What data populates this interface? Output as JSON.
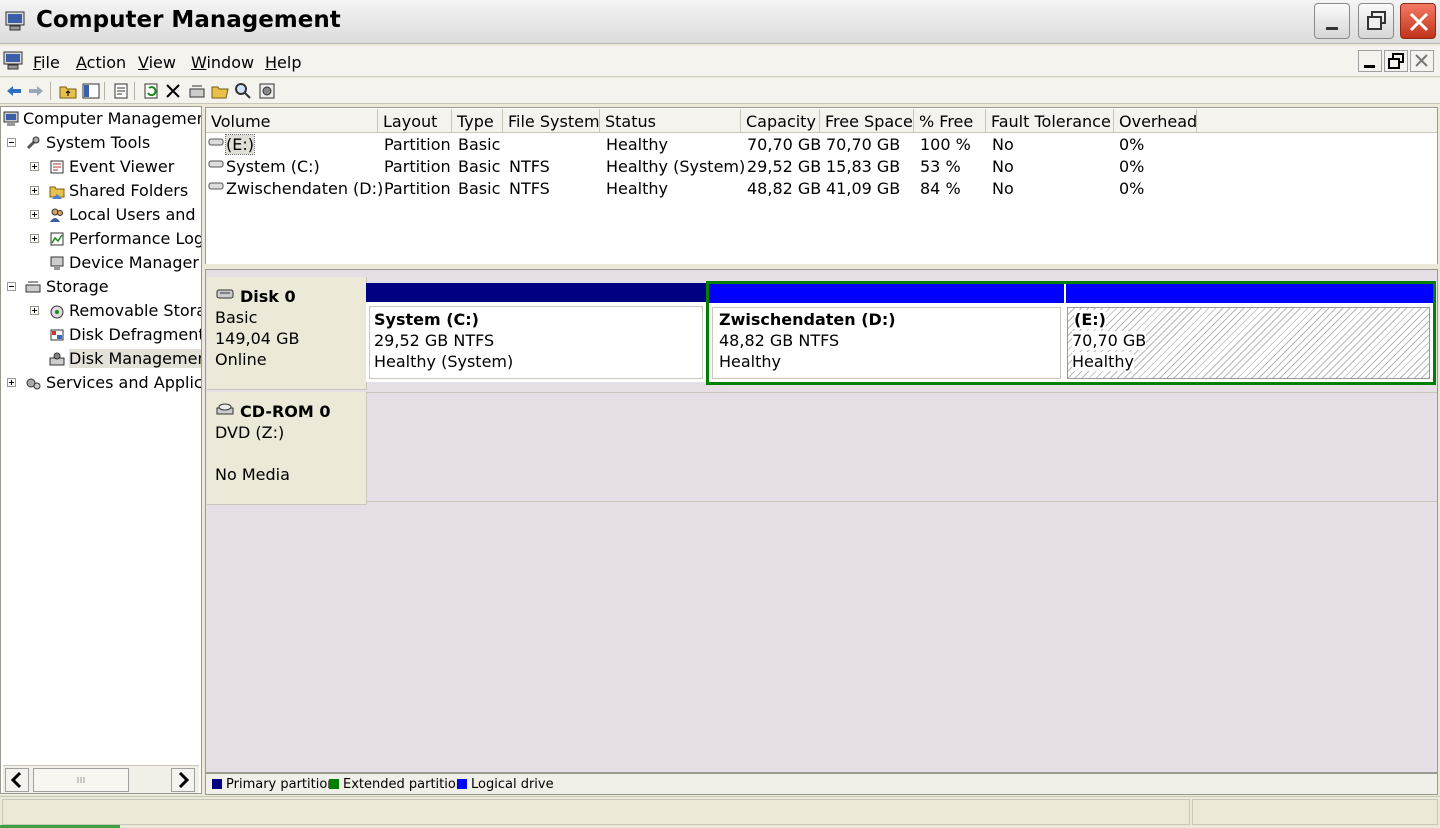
{
  "window": {
    "title": "Computer Management"
  },
  "menu": {
    "items": [
      {
        "label": "File",
        "accel": "F",
        "rest": "ile"
      },
      {
        "label": "Action",
        "accel": "A",
        "rest": "ction"
      },
      {
        "label": "View",
        "accel": "V",
        "rest": "iew"
      },
      {
        "label": "Window",
        "accel": "W",
        "rest": "indow"
      },
      {
        "label": "Help",
        "accel": "H",
        "rest": "elp"
      }
    ]
  },
  "tree": {
    "items": [
      {
        "label": "Computer Management"
      },
      {
        "label": "System Tools"
      },
      {
        "label": "Event Viewer"
      },
      {
        "label": "Shared Folders"
      },
      {
        "label": "Local Users and G"
      },
      {
        "label": "Performance Logs"
      },
      {
        "label": "Device Manager"
      },
      {
        "label": "Storage"
      },
      {
        "label": "Removable Storag"
      },
      {
        "label": "Disk Defragmente"
      },
      {
        "label": "Disk Management"
      },
      {
        "label": "Services and Applica"
      }
    ]
  },
  "volumes": {
    "columns": [
      "Volume",
      "Layout",
      "Type",
      "File System",
      "Status",
      "Capacity",
      "Free Space",
      "% Free",
      "Fault Tolerance",
      "Overhead"
    ],
    "rows": [
      {
        "volume": " (E:)",
        "layout": "Partition",
        "type": "Basic",
        "fs": "",
        "status": "Healthy",
        "capacity": "70,70 GB",
        "free": "70,70 GB",
        "pct": "100 %",
        "fault": "No",
        "overhead": "0%"
      },
      {
        "volume": "System (C:)",
        "layout": "Partition",
        "type": "Basic",
        "fs": "NTFS",
        "status": "Healthy (System)",
        "capacity": "29,52 GB",
        "free": "15,83 GB",
        "pct": "53 %",
        "fault": "No",
        "overhead": "0%"
      },
      {
        "volume": "Zwischendaten (D:)",
        "layout": "Partition",
        "type": "Basic",
        "fs": "NTFS",
        "status": "Healthy",
        "capacity": "48,82 GB",
        "free": "41,09 GB",
        "pct": "84 %",
        "fault": "No",
        "overhead": "0%"
      }
    ]
  },
  "disks": {
    "disk0": {
      "name": "Disk 0",
      "type": "Basic",
      "size": "149,04 GB",
      "state": "Online",
      "partitions": [
        {
          "name": "System  (C:)",
          "size": "29,52 GB NTFS",
          "status": "Healthy (System)",
          "kind": "primary"
        },
        {
          "name": "Zwischendaten  (D:)",
          "size": "48,82 GB NTFS",
          "status": "Healthy",
          "kind": "logical"
        },
        {
          "name": " (E:)",
          "size": "70,70 GB",
          "status": "Healthy",
          "kind": "logical"
        }
      ]
    },
    "cdrom0": {
      "name": "CD-ROM 0",
      "drive": "DVD (Z:)",
      "media": "No Media"
    }
  },
  "legend": {
    "items": [
      {
        "label": "Primary partition",
        "color": "#000080"
      },
      {
        "label": "Extended partition",
        "color": "#008000"
      },
      {
        "label": "Logical drive",
        "color": "#0000ff"
      }
    ]
  },
  "colors": {
    "primary": "#000080",
    "extended": "#008000",
    "logical": "#0000ff",
    "selection": "#e3e1d8"
  }
}
